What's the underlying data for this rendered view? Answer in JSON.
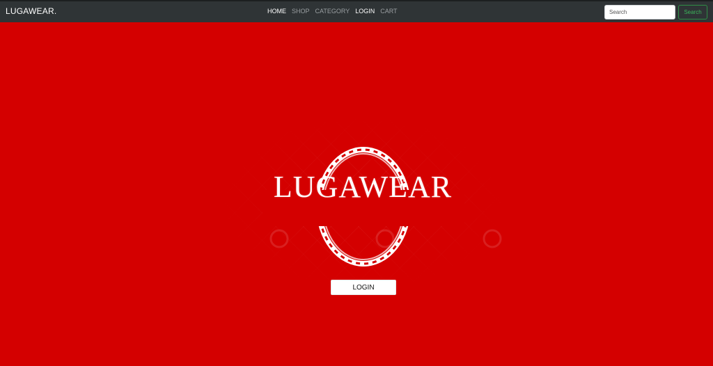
{
  "header": {
    "brand": "LUGAWEAR.",
    "nav": [
      {
        "label": "HOME"
      },
      {
        "label": "SHOP"
      },
      {
        "label": "CATEGORY"
      },
      {
        "label": "LOGIN"
      },
      {
        "label": "CART"
      }
    ],
    "search": {
      "placeholder": "Search",
      "value": "",
      "button_label": "Search"
    }
  },
  "hero": {
    "logo_text": "LUGAWEAR",
    "login_label": "LOGIN"
  },
  "colors": {
    "background": "#d40000",
    "nav_bar": "#2f3436",
    "search_button": "#3cb55b"
  }
}
